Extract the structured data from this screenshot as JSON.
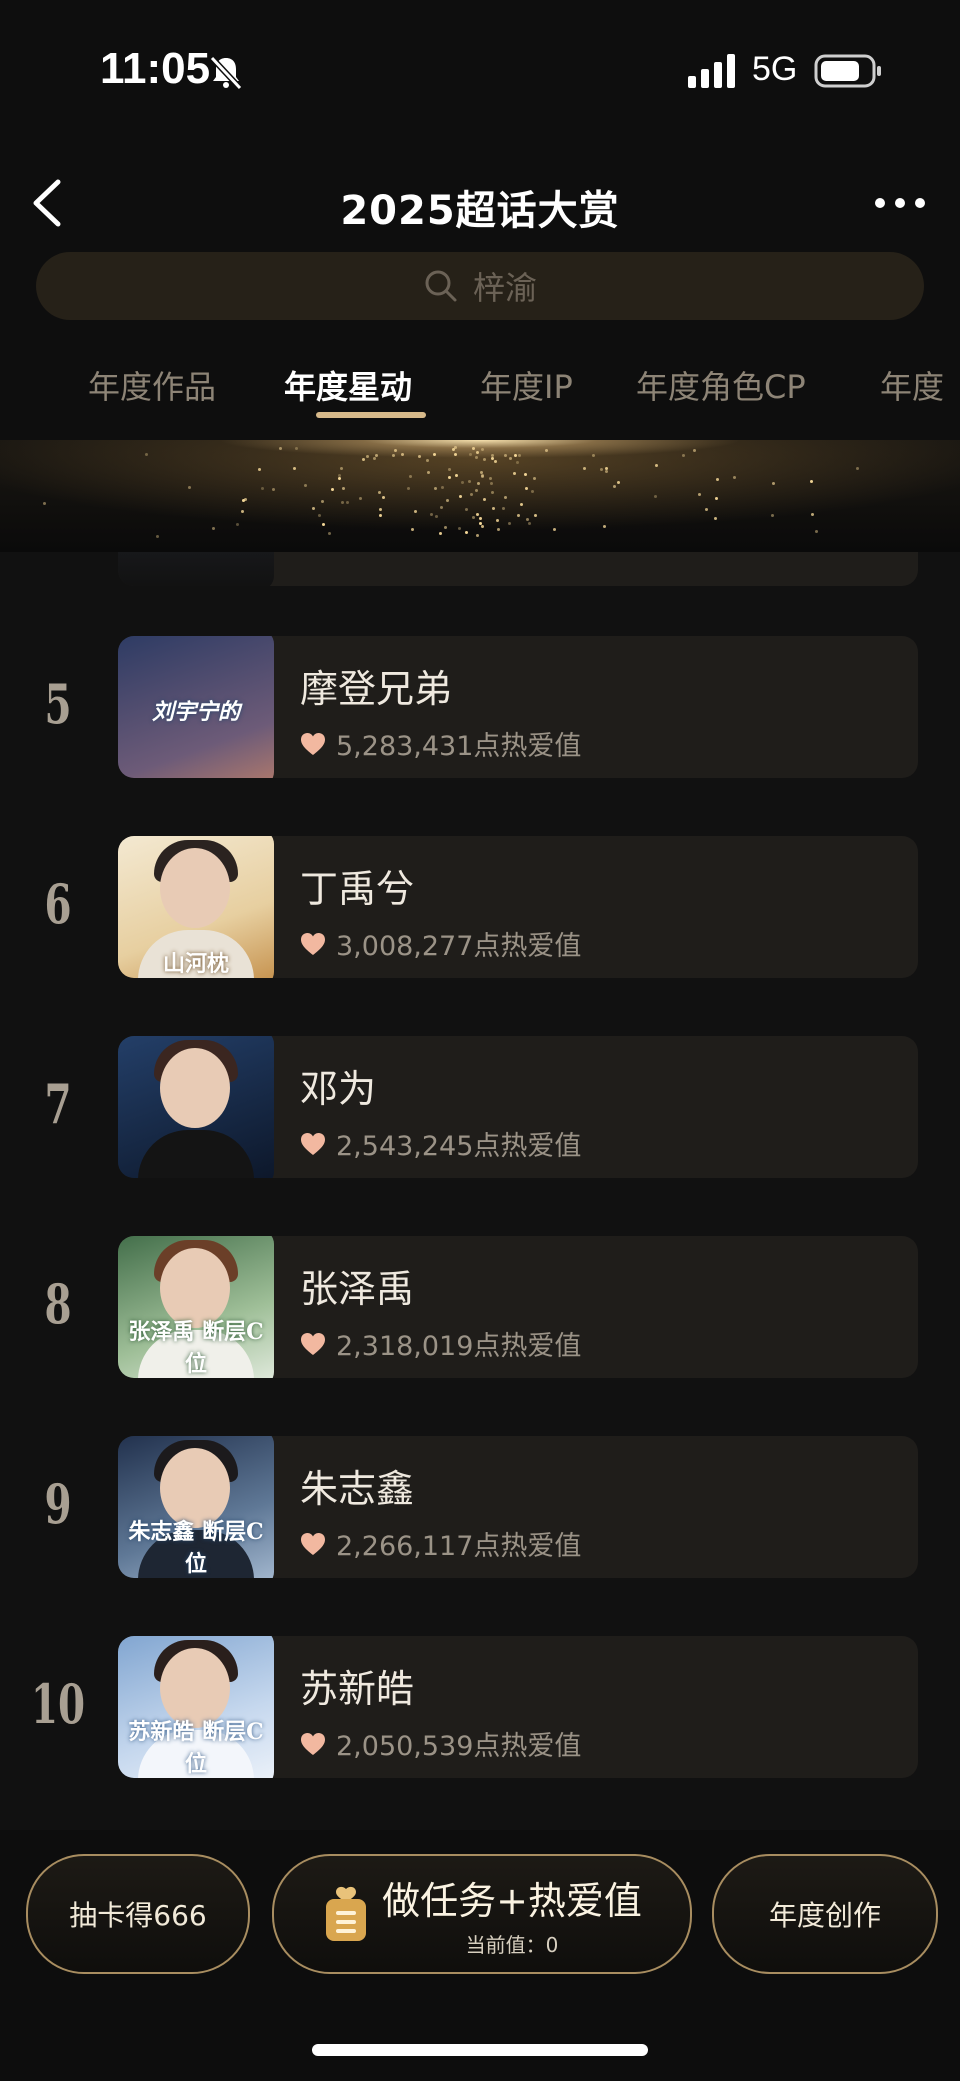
{
  "status_bar": {
    "time": "11:05",
    "network": "5G"
  },
  "header": {
    "title": "2025超话大赏",
    "search_placeholder": "梓渝",
    "tabs": [
      {
        "label": "年度作品",
        "active": false
      },
      {
        "label": "年度星动",
        "active": true
      },
      {
        "label": "年度IP",
        "active": false
      },
      {
        "label": "年度角色CP",
        "active": false
      },
      {
        "label": "年度",
        "active": false
      }
    ]
  },
  "ranking": [
    {
      "rank": "5",
      "name": "摩登兄弟",
      "score": "5,283,431点热爱值",
      "thumb_caption": "刘宇宁的",
      "thumb_colors": [
        "#3c4f7a",
        "#b17a6e"
      ]
    },
    {
      "rank": "6",
      "name": "丁禹兮",
      "score": "3,008,277点热爱值",
      "thumb_caption": "山河枕",
      "thumb_colors": [
        "#f1e6cc",
        "#d7a55c"
      ]
    },
    {
      "rank": "7",
      "name": "邓为",
      "score": "2,543,245点热爱值",
      "thumb_caption": "",
      "thumb_colors": [
        "#1f3552",
        "#0b1422"
      ]
    },
    {
      "rank": "8",
      "name": "张泽禹",
      "score": "2,318,019点热爱值",
      "thumb_caption": "张泽禹 断层C位",
      "thumb_colors": [
        "#4f7a55",
        "#a9c3a4"
      ]
    },
    {
      "rank": "9",
      "name": "朱志鑫",
      "score": "2,266,117点热爱值",
      "thumb_caption": "朱志鑫 断层C位",
      "thumb_colors": [
        "#23334f",
        "#8aa1bd"
      ]
    },
    {
      "rank": "10",
      "name": "苏新皓",
      "score": "2,050,539点热爱值",
      "thumb_caption": "苏新皓 断层C位",
      "thumb_colors": [
        "#8db0d8",
        "#dbe7f3"
      ]
    }
  ],
  "bottom_bar": {
    "left_button": "抽卡得666",
    "center_title": "做任务+热爱值",
    "center_sub": "当前值：0",
    "right_button": "年度创作"
  },
  "colors": {
    "background": "#111111",
    "card": "#1f1d1a",
    "accent_gold": "#d7b98a",
    "heart": "#f2b8a0"
  }
}
